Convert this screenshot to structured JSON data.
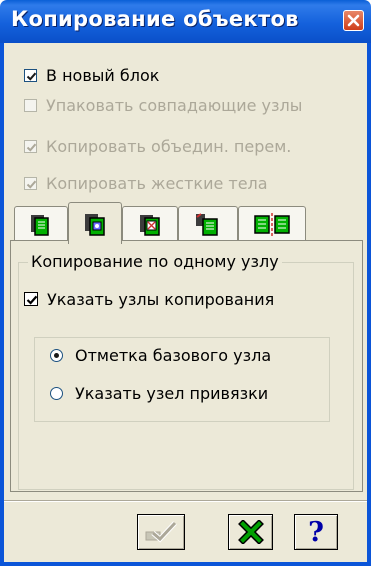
{
  "window": {
    "title": "Копирование объектов",
    "close_icon": "close-x"
  },
  "options": {
    "new_block": {
      "label": "В новый блок",
      "checked": true,
      "enabled": true
    },
    "pack_nodes": {
      "label": "Упаковать совпадающие узлы",
      "checked": false,
      "enabled": false
    },
    "copy_merged_vars": {
      "label": "Копировать объедин. перем.",
      "checked": true,
      "enabled": false
    },
    "copy_rigid_bodies": {
      "label": "Копировать жесткие тела",
      "checked": true,
      "enabled": false
    }
  },
  "tabs": [
    {
      "name": "copy-simple",
      "icon": "copy-simple-icon",
      "active": false
    },
    {
      "name": "copy-by-node",
      "icon": "copy-by-node-icon",
      "active": true
    },
    {
      "name": "copy-rotate",
      "icon": "copy-rotate-icon",
      "active": false
    },
    {
      "name": "copy-mirror",
      "icon": "copy-mirror-icon",
      "active": false
    },
    {
      "name": "copy-symmetric",
      "icon": "copy-symmetric-icon",
      "active": false
    }
  ],
  "panel": {
    "group_title": "Копирование по одному узлу",
    "specify_nodes": {
      "label": "Указать узлы копирования",
      "checked": true
    },
    "radios": [
      {
        "label": "Отметка базового узла",
        "selected": true
      },
      {
        "label": "Указать узел привязки",
        "selected": false
      }
    ]
  },
  "buttons": {
    "apply": {
      "icon": "apply-check-icon",
      "enabled": false
    },
    "cancel": {
      "icon": "cancel-x-icon",
      "enabled": true
    },
    "help": {
      "label": "?",
      "icon": "help-icon",
      "enabled": true
    }
  },
  "colors": {
    "titlebar": "#0b55d8",
    "face": "#ece9d8",
    "disabled_text": "#aca899",
    "help_blue": "#0000a8",
    "cancel_green": "#00a000"
  }
}
